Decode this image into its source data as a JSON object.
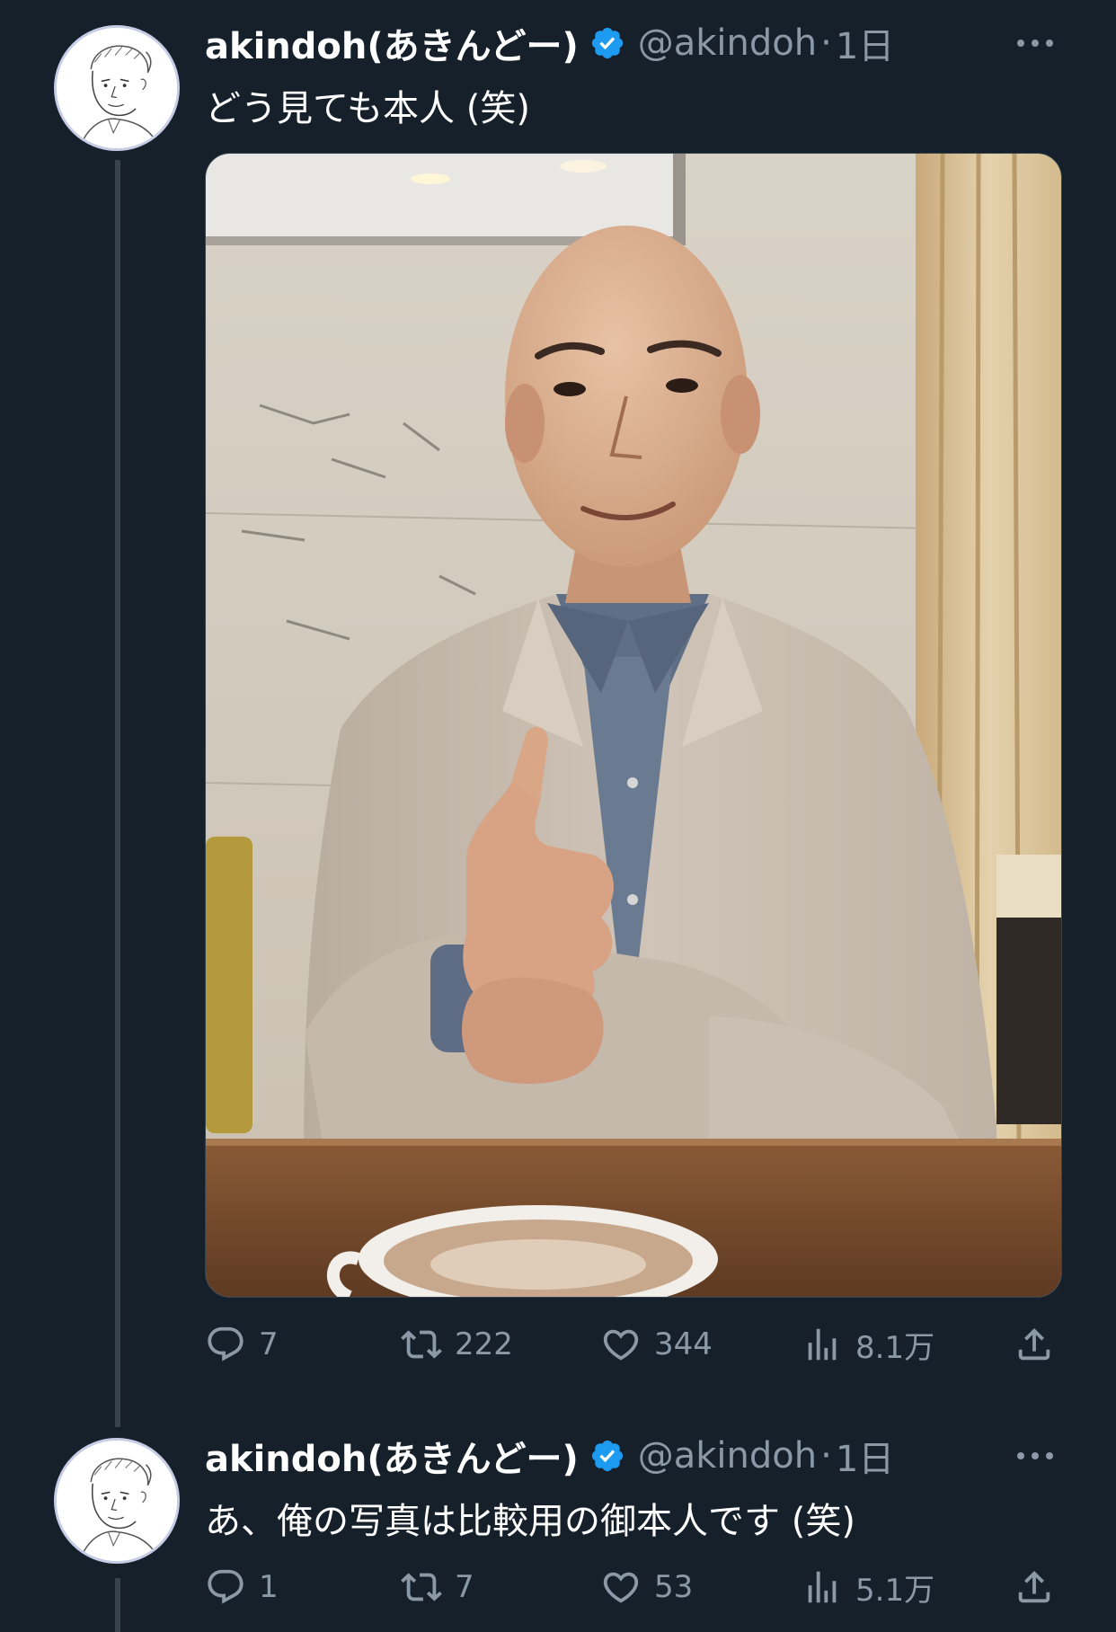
{
  "tweets": [
    {
      "display_name": "akindoh(あきんどー)",
      "handle": "@akindoh",
      "separator": "·",
      "time": "1日",
      "text": "どう見ても本人 (笑)",
      "has_media": true,
      "stats": {
        "replies": "7",
        "retweets": "222",
        "likes": "344",
        "views": "8.1万"
      }
    },
    {
      "display_name": "akindoh(あきんどー)",
      "handle": "@akindoh",
      "separator": "·",
      "time": "1日",
      "text": "あ、俺の写真は比較用の御本人です (笑)",
      "has_media": false,
      "stats": {
        "replies": "1",
        "retweets": "7",
        "likes": "53",
        "views": "5.1万"
      }
    }
  ],
  "icons": {
    "verified": "verified-badge-icon",
    "more": "more-options-icon",
    "reply": "reply-icon",
    "retweet": "retweet-icon",
    "like": "heart-icon",
    "views": "views-chart-icon",
    "share": "share-icon"
  },
  "colors": {
    "background": "#15202b",
    "secondary_text": "#8b98a5",
    "verified_blue": "#1d9bf0",
    "thread_line": "#38444d"
  }
}
